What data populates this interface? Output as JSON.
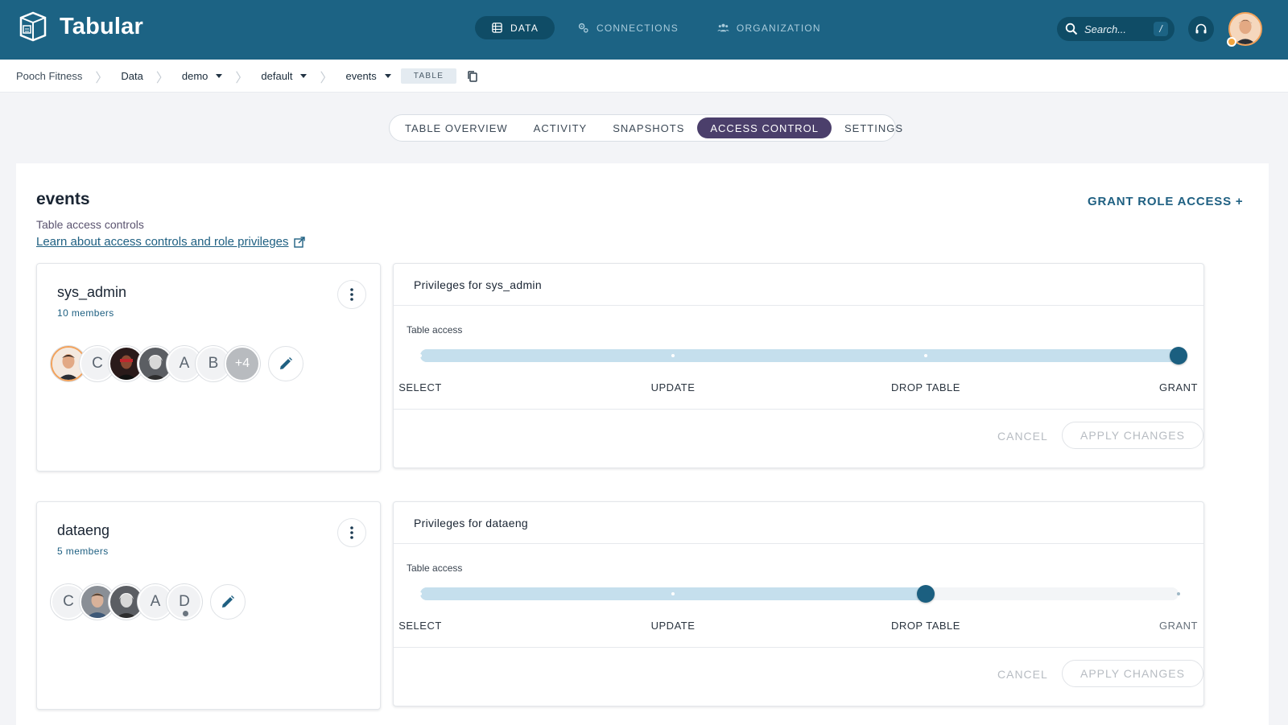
{
  "app": {
    "name": "Tabular"
  },
  "nav": [
    {
      "label": "DATA",
      "icon": "database-icon",
      "active": true
    },
    {
      "label": "CONNECTIONS",
      "icon": "gears-icon",
      "active": false
    },
    {
      "label": "ORGANIZATION",
      "icon": "people-icon",
      "active": false
    }
  ],
  "search": {
    "placeholder": "Search...",
    "shortcut": "/"
  },
  "breadcrumb": {
    "org": "Pooch Fitness",
    "section": "Data",
    "warehouse": "demo",
    "database": "default",
    "table": "events",
    "type_badge": "TABLE"
  },
  "tabs": [
    {
      "label": "TABLE OVERVIEW",
      "active": false
    },
    {
      "label": "ACTIVITY",
      "active": false
    },
    {
      "label": "SNAPSHOTS",
      "active": false
    },
    {
      "label": "ACCESS CONTROL",
      "active": true
    },
    {
      "label": "SETTINGS",
      "active": false
    }
  ],
  "page": {
    "title": "events",
    "subtitle": "Table access controls",
    "learn_link": "Learn about access controls and role privileges",
    "grant_button": "GRANT ROLE ACCESS +"
  },
  "privilege_levels": [
    "SELECT",
    "UPDATE",
    "DROP TABLE",
    "GRANT"
  ],
  "roles": [
    {
      "name": "sys_admin",
      "members": "10 members",
      "avatars": [
        {
          "kind": "photo",
          "tone": "a"
        },
        {
          "kind": "initial",
          "text": "C"
        },
        {
          "kind": "photo",
          "tone": "b"
        },
        {
          "kind": "photo",
          "tone": "c"
        },
        {
          "kind": "initial",
          "text": "A"
        },
        {
          "kind": "initial",
          "text": "B"
        },
        {
          "kind": "more",
          "text": "+4"
        }
      ],
      "privileges_title": "Privileges for sys_admin",
      "access_label": "Table access",
      "level_index": 3,
      "cancel": "CANCEL",
      "apply": "APPLY CHANGES"
    },
    {
      "name": "dataeng",
      "members": "5 members",
      "avatars": [
        {
          "kind": "initial",
          "text": "C"
        },
        {
          "kind": "photo",
          "tone": "d"
        },
        {
          "kind": "photo",
          "tone": "c"
        },
        {
          "kind": "initial",
          "text": "A"
        },
        {
          "kind": "initial",
          "text": "D",
          "status": true
        }
      ],
      "privileges_title": "Privileges for dataeng",
      "access_label": "Table access",
      "level_index": 2,
      "cancel": "CANCEL",
      "apply": "APPLY CHANGES"
    }
  ],
  "colors": {
    "appbar": "#1c6384",
    "accent": "#1f6082",
    "active_tab": "#4b3f6b",
    "slider_track": "#c5dfed",
    "slider_thumb": "#1b5f80"
  }
}
